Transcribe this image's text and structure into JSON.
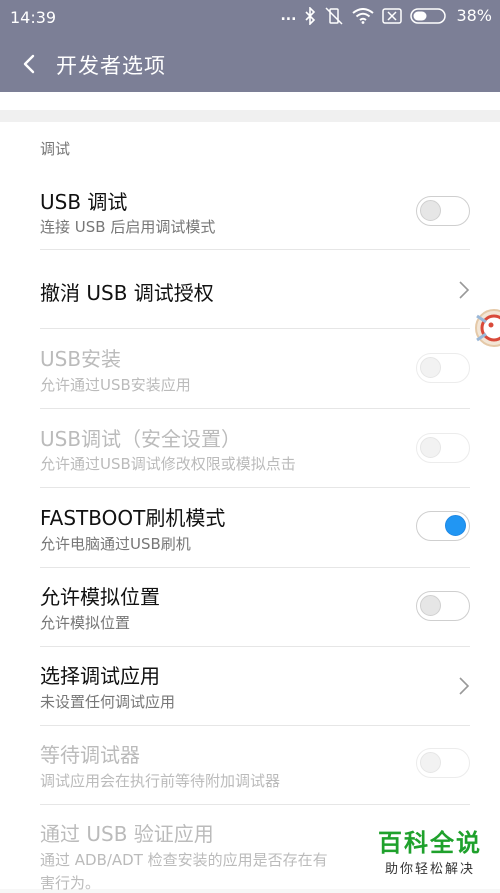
{
  "status_bar": {
    "time": "14:39",
    "dots": "...",
    "battery_percent": "38%"
  },
  "app_bar": {
    "title": "开发者选项"
  },
  "section": {
    "header": "调试"
  },
  "items": [
    {
      "title": "USB 调试",
      "subtitle": "连接 USB 后启用调试模式",
      "control": "toggle",
      "state": "off",
      "enabled": true
    },
    {
      "title": "撤消 USB 调试授权",
      "subtitle": "",
      "control": "chevron",
      "enabled": true
    },
    {
      "title": "USB安装",
      "subtitle": "允许通过USB安装应用",
      "control": "toggle",
      "state": "off",
      "enabled": false
    },
    {
      "title": "USB调试（安全设置）",
      "subtitle": "允许通过USB调试修改权限或模拟点击",
      "control": "toggle",
      "state": "off",
      "enabled": false
    },
    {
      "title": "FASTBOOT刷机模式",
      "subtitle": "允许电脑通过USB刷机",
      "control": "toggle",
      "state": "on",
      "enabled": true
    },
    {
      "title": "允许模拟位置",
      "subtitle": "允许模拟位置",
      "control": "toggle",
      "state": "off",
      "enabled": true
    },
    {
      "title": "选择调试应用",
      "subtitle": "未设置任何调试应用",
      "control": "chevron",
      "enabled": true
    },
    {
      "title": "等待调试器",
      "subtitle": "调试应用会在执行前等待附加调试器",
      "control": "toggle",
      "state": "off",
      "enabled": false
    },
    {
      "title": "通过 USB 验证应用",
      "subtitle": "通过 ADB/ADT 检查安装的应用是否存在有",
      "subtitle2": "害行为。",
      "control": "none",
      "enabled": false
    }
  ],
  "watermark": {
    "line1": "百科全说",
    "line2": "助你轻松解决"
  },
  "colors": {
    "header_bg": "#7c7f96",
    "accent": "#2196f3",
    "watermark_green": "#1fa12c"
  }
}
